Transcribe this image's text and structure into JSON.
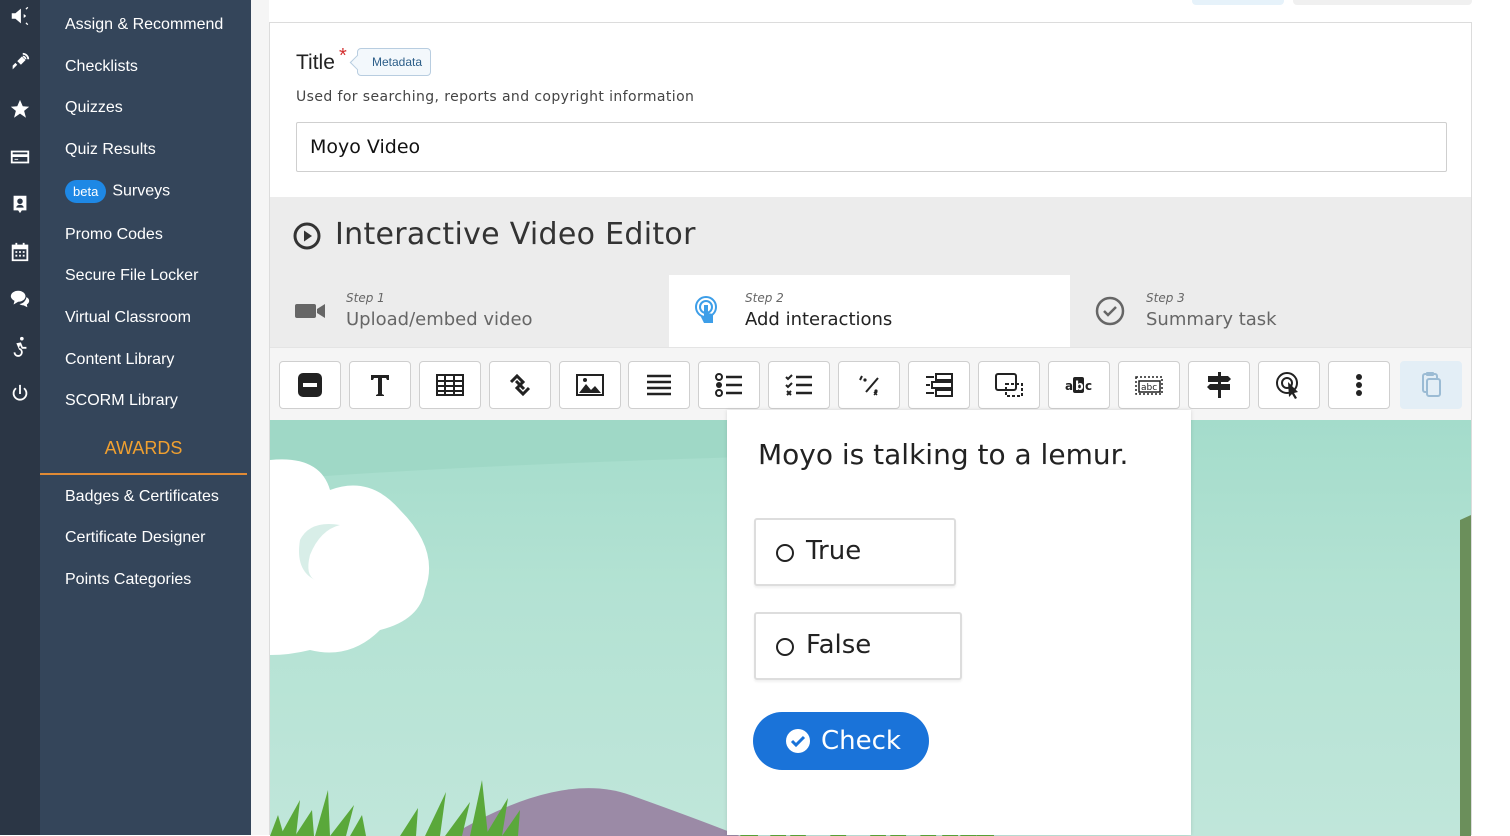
{
  "nav": {
    "items": [
      {
        "label": "Assign & Recommend"
      },
      {
        "label": "Checklists"
      },
      {
        "label": "Quizzes"
      },
      {
        "label": "Quiz Results"
      },
      {
        "label": "Surveys",
        "badge": "beta"
      },
      {
        "label": "Promo Codes"
      },
      {
        "label": "Secure File Locker"
      },
      {
        "label": "Virtual Classroom"
      },
      {
        "label": "Content Library"
      },
      {
        "label": "SCORM Library"
      }
    ],
    "section_heading": "AWARDS",
    "award_items": [
      {
        "label": "Badges & Certificates"
      },
      {
        "label": "Certificate Designer"
      },
      {
        "label": "Points Categories"
      }
    ]
  },
  "rail_icons": [
    "megaphone-icon",
    "satellite-icon",
    "star-icon",
    "credit-card-icon",
    "user-badge-icon",
    "calendar-icon",
    "chat-icon",
    "accessibility-icon",
    "power-icon"
  ],
  "form": {
    "title_label": "Title",
    "required_mark": "*",
    "metadata_tag": "Metadata",
    "title_description": "Used for searching, reports and copyright information",
    "title_value": "Moyo Video"
  },
  "editor": {
    "heading": "Interactive Video Editor",
    "steps": [
      {
        "step": "Step 1",
        "name": "Upload/embed video"
      },
      {
        "step": "Step 2",
        "name": "Add interactions"
      },
      {
        "step": "Step 3",
        "name": "Summary task"
      }
    ],
    "toolbar_icons": [
      "label-icon",
      "text-icon",
      "table-icon",
      "link-icon",
      "image-icon",
      "statements-icon",
      "single-choice-icon",
      "multiple-choice-icon",
      "fill-blanks-icon",
      "drag-text-icon",
      "drag-drop-icon",
      "mark-words-icon",
      "drag-words-icon",
      "crossroads-icon",
      "navigation-hotspot-icon",
      "more-icon",
      "paste-icon"
    ]
  },
  "quiz": {
    "question": "Moyo is talking to a lemur.",
    "options": [
      {
        "label": "True"
      },
      {
        "label": "False"
      }
    ],
    "check_label": "Check"
  },
  "colors": {
    "rail_bg": "#2b3645",
    "nav_bg": "#34455a",
    "awards_accent": "#f0a030",
    "beta_badge": "#1e88e5",
    "check_button": "#1a73d9",
    "video_sky": "#b3e2d3"
  }
}
